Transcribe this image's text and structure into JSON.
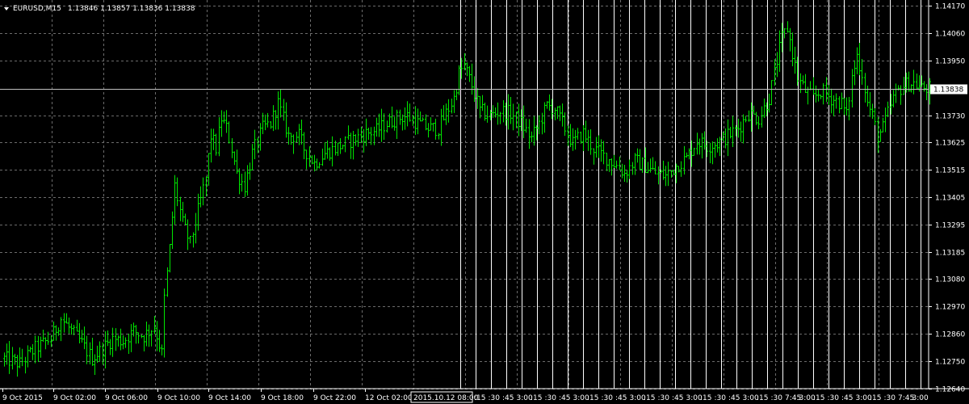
{
  "header": {
    "symbol_timeframe": "EURUSD,M15",
    "ohlc": "1.13846 1.13857 1.13836 1.13838"
  },
  "colors": {
    "background": "#000000",
    "bar": "#00e600",
    "grid": "#6b6b6b",
    "vertical_lines": "#ffffff",
    "bid_line": "#c0c0c0",
    "axis": "#ffffff",
    "price_label_bg": "#ffffff",
    "price_label_text": "#000000"
  },
  "icons": {
    "dropdown": "triangle-down-icon"
  },
  "chart_data": {
    "type": "ohlc",
    "symbol": "EURUSD",
    "timeframe": "M15",
    "current_price": 1.13838,
    "ylim": [
      1.1264,
      1.1417
    ],
    "y_ticks": [
      "1.14170",
      "1.14060",
      "1.13950",
      "1.13838",
      "1.13730",
      "1.13625",
      "1.13515",
      "1.13405",
      "1.13295",
      "1.13185",
      "1.13080",
      "1.12970",
      "1.12860",
      "1.12750",
      "1.12640"
    ],
    "x_tick_labels": [
      "9 Oct 2015",
      "9 Oct 02:00",
      "9 Oct 06:00",
      "9 Oct 10:00",
      "9 Oct 14:00",
      "9 Oct 18:00",
      "9 Oct 22:00",
      "12 Oct 02:00"
    ],
    "highlight_time_label": "2015.10.12 08:00",
    "crowded_time_labels": [
      ":15",
      ":30",
      ":45",
      "3:00",
      ":15",
      ":30",
      ":45",
      "3:00",
      ":15",
      ":30",
      ":45",
      "3:00",
      ":15",
      ":30",
      ":45",
      "3:00",
      ":15",
      ":30",
      ":45",
      "3:00",
      ":15",
      ":30",
      "7:45",
      "3:00",
      ":15",
      ":30",
      ":45",
      "3:00",
      ":15",
      ":30",
      "7:45",
      "3:00"
    ],
    "close_path": [
      [
        0,
        1.1276
      ],
      [
        6,
        1.1274
      ],
      [
        12,
        1.128
      ],
      [
        18,
        1.1284
      ],
      [
        22,
        1.1292
      ],
      [
        26,
        1.1287
      ],
      [
        30,
        1.1282
      ],
      [
        34,
        1.1276
      ],
      [
        38,
        1.128
      ],
      [
        42,
        1.1284
      ],
      [
        46,
        1.1283
      ],
      [
        50,
        1.1287
      ],
      [
        54,
        1.1285
      ],
      [
        58,
        1.1289
      ],
      [
        61,
        1.1278
      ],
      [
        62,
        1.13
      ],
      [
        64,
        1.132
      ],
      [
        66,
        1.1345
      ],
      [
        69,
        1.133
      ],
      [
        72,
        1.1322
      ],
      [
        75,
        1.1335
      ],
      [
        78,
        1.1348
      ],
      [
        80,
        1.1365
      ],
      [
        82,
        1.136
      ],
      [
        84,
        1.1372
      ],
      [
        86,
        1.1368
      ],
      [
        88,
        1.136
      ],
      [
        90,
        1.135
      ],
      [
        93,
        1.1345
      ],
      [
        96,
        1.1358
      ],
      [
        100,
        1.1368
      ],
      [
        103,
        1.137
      ],
      [
        106,
        1.1378
      ],
      [
        110,
        1.1365
      ],
      [
        114,
        1.1365
      ],
      [
        116,
        1.136
      ],
      [
        118,
        1.1357
      ],
      [
        120,
        1.1354
      ],
      [
        124,
        1.1358
      ],
      [
        128,
        1.136
      ],
      [
        132,
        1.1362
      ],
      [
        136,
        1.1364
      ],
      [
        140,
        1.1366
      ],
      [
        144,
        1.1367
      ],
      [
        148,
        1.137
      ],
      [
        152,
        1.1372
      ],
      [
        156,
        1.1373
      ],
      [
        160,
        1.137
      ],
      [
        164,
        1.1368
      ],
      [
        168,
        1.1368
      ],
      [
        170,
        1.1372
      ],
      [
        172,
        1.1376
      ],
      [
        174,
        1.138
      ],
      [
        176,
        1.139
      ],
      [
        178,
        1.1393
      ],
      [
        181,
        1.1385
      ],
      [
        184,
        1.1375
      ],
      [
        188,
        1.1373
      ],
      [
        192,
        1.1375
      ],
      [
        196,
        1.1374
      ],
      [
        200,
        1.137
      ],
      [
        204,
        1.1364
      ],
      [
        207,
        1.137
      ],
      [
        210,
        1.1377
      ],
      [
        213,
        1.1376
      ],
      [
        216,
        1.137
      ],
      [
        220,
        1.1362
      ],
      [
        224,
        1.1366
      ],
      [
        228,
        1.136
      ],
      [
        232,
        1.1357
      ],
      [
        236,
        1.1354
      ],
      [
        240,
        1.135
      ],
      [
        244,
        1.1355
      ],
      [
        248,
        1.1353
      ],
      [
        252,
        1.135
      ],
      [
        256,
        1.1349
      ],
      [
        260,
        1.1353
      ],
      [
        264,
        1.1356
      ],
      [
        268,
        1.1363
      ],
      [
        272,
        1.1361
      ],
      [
        276,
        1.1362
      ],
      [
        280,
        1.1365
      ],
      [
        284,
        1.1368
      ],
      [
        288,
        1.1374
      ],
      [
        292,
        1.1372
      ],
      [
        296,
        1.138
      ],
      [
        299,
        1.1395
      ],
      [
        301,
        1.1404
      ],
      [
        303,
        1.1408
      ],
      [
        305,
        1.1398
      ],
      [
        307,
        1.1388
      ],
      [
        310,
        1.1383
      ],
      [
        313,
        1.138
      ],
      [
        316,
        1.1383
      ],
      [
        320,
        1.138
      ],
      [
        324,
        1.1378
      ],
      [
        326,
        1.1373
      ],
      [
        328,
        1.1388
      ],
      [
        330,
        1.1397
      ],
      [
        332,
        1.139
      ],
      [
        334,
        1.1378
      ],
      [
        336,
        1.1373
      ],
      [
        338,
        1.1365
      ],
      [
        340,
        1.1368
      ],
      [
        342,
        1.1374
      ],
      [
        344,
        1.138
      ],
      [
        346,
        1.1383
      ],
      [
        348,
        1.1385
      ],
      [
        350,
        1.1386
      ],
      [
        352,
        1.1386
      ],
      [
        355,
        1.1384
      ],
      [
        358,
        1.1384
      ]
    ]
  }
}
